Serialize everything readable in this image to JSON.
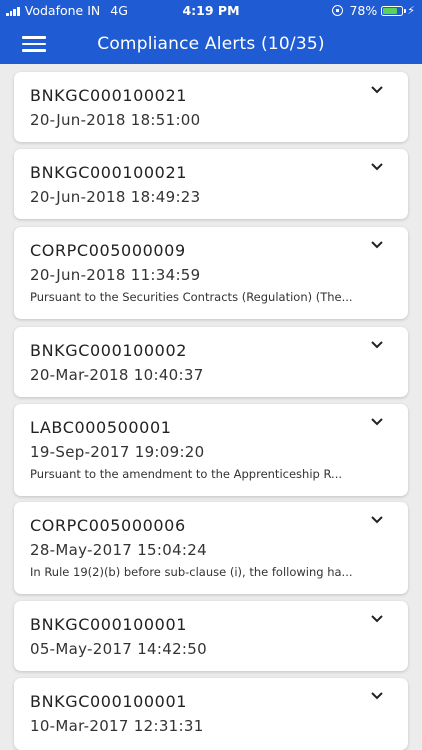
{
  "status_bar": {
    "carrier": "Vodafone IN",
    "network": "4G",
    "time": "4:19 PM",
    "battery": "78%"
  },
  "header": {
    "title": "Compliance Alerts (10/35)"
  },
  "alerts": [
    {
      "id": "BNKGC000100021",
      "date": "20-Jun-2018 18:51:00",
      "description": ""
    },
    {
      "id": "BNKGC000100021",
      "date": "20-Jun-2018 18:49:23",
      "description": ""
    },
    {
      "id": "CORPC005000009",
      "date": "20-Jun-2018 11:34:59",
      "description": "Pursuant to the Securities Contracts (Regulation) (The..."
    },
    {
      "id": "BNKGC000100002",
      "date": "20-Mar-2018 10:40:37",
      "description": ""
    },
    {
      "id": "LABC000500001",
      "date": "19-Sep-2017 19:09:20",
      "description": "Pursuant to the amendment to the Apprenticeship R..."
    },
    {
      "id": "CORPC005000006",
      "date": "28-May-2017 15:04:24",
      "description": "In Rule 19(2)(b) before sub-clause (i), the following ha..."
    },
    {
      "id": "BNKGC000100001",
      "date": "05-May-2017 14:42:50",
      "description": ""
    },
    {
      "id": "BNKGC000100001",
      "date": "10-Mar-2017 12:31:31",
      "description": ""
    }
  ],
  "colors": {
    "header_bg": "#1f5bd3",
    "page_bg": "#ececec",
    "card_bg": "#ffffff"
  }
}
